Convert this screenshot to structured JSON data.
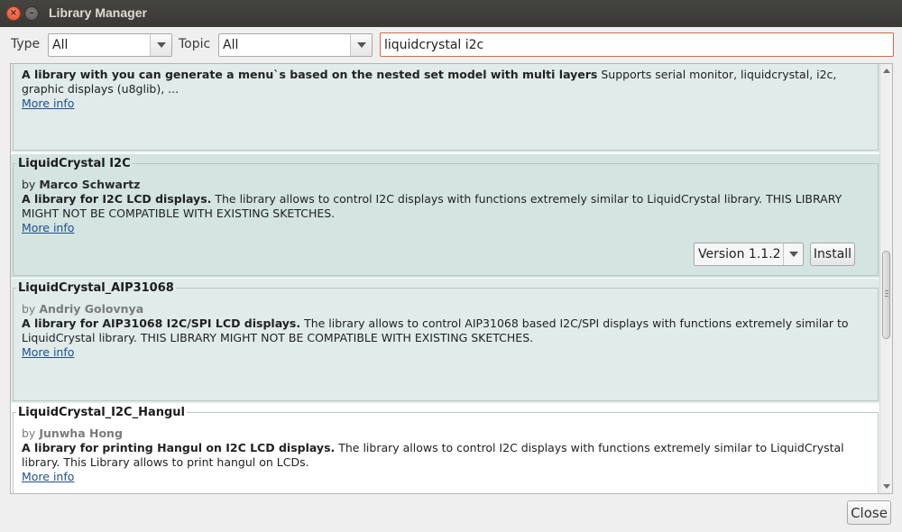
{
  "window": {
    "title": "Library Manager"
  },
  "filters": {
    "type_label": "Type",
    "type_value": "All",
    "topic_label": "Topic",
    "topic_value": "All",
    "search_value": "liquidcrystal i2c"
  },
  "libraries": [
    {
      "name": "",
      "author_prefix": "",
      "author": "",
      "desc_bold": "A library with you can generate a menu`s based on the nested set model with multi layers",
      "desc_rest": " Supports serial monitor, liquidcrystal, i2c, graphic displays (u8glib), ...",
      "more": "More info"
    },
    {
      "name": "LiquidCrystal I2C",
      "author_prefix": "by ",
      "author": "Marco Schwartz",
      "desc_bold": "A library for I2C LCD displays.",
      "desc_rest": " The library allows to control I2C displays with functions extremely similar to LiquidCrystal library. THIS LIBRARY MIGHT NOT BE COMPATIBLE WITH EXISTING SKETCHES.",
      "more": "More info",
      "version": "Version 1.1.2",
      "install": "Install"
    },
    {
      "name": "LiquidCrystal_AIP31068",
      "author_prefix": "by ",
      "author": "Andriy Golovnya",
      "desc_bold": "A library for AIP31068 I2C/SPI LCD displays.",
      "desc_rest": " The library allows to control AIP31068 based I2C/SPI displays with functions extremely similar to LiquidCrystal library. THIS LIBRARY MIGHT NOT BE COMPATIBLE WITH EXISTING SKETCHES.",
      "more": "More info"
    },
    {
      "name": "LiquidCrystal_I2C_Hangul",
      "author_prefix": "by ",
      "author": "Junwha Hong",
      "desc_bold": "A library for printing Hangul on I2C LCD displays.",
      "desc_rest": " The library allows to control I2C displays with functions extremely similar to LiquidCrystal library. This Library allows to print hangul on LCDs.",
      "more": "More info"
    }
  ],
  "footer": {
    "close": "Close"
  },
  "colors": {
    "search_border": "#d9693e",
    "link": "#1f4f8a",
    "row_teal": "#e0ebea",
    "row_selected": "#d3e4e1"
  }
}
